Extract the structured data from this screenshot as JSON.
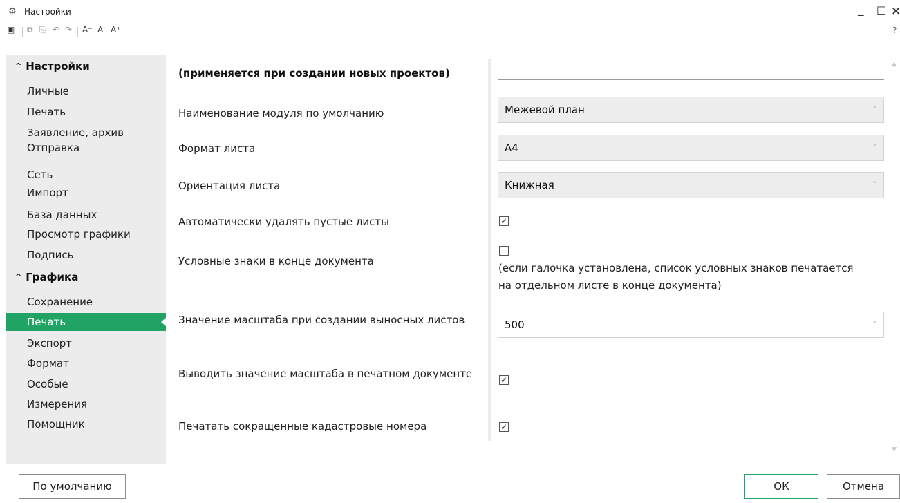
{
  "window": {
    "title": "Настройки",
    "help_label": "?"
  },
  "sidebar": {
    "groups": [
      {
        "label": "Настройки",
        "items": [
          "Личные",
          "Печать",
          "Заявление, архив",
          "Отправка",
          "Сеть",
          "Импорт",
          "База данных",
          "Просмотр графики",
          "Подпись"
        ]
      },
      {
        "label": "Графика",
        "items": [
          "Сохранение",
          "Печать",
          "Экспорт",
          "Формат",
          "Особые",
          "Измерения",
          "Помощник"
        ]
      }
    ],
    "active_item": "Графика / Печать",
    "accent_color": "#21a366"
  },
  "main": {
    "section_heading": "(применяется при создании новых проектов)",
    "fields": {
      "module_name": {
        "label": "Наименование модуля по умолчанию",
        "value": "Межевой план"
      },
      "sheet_format": {
        "label": "Формат листа",
        "value": "А4"
      },
      "orientation": {
        "label": "Ориентация листа",
        "value": "Книжная"
      },
      "auto_delete": {
        "label": "Автоматически удалять пустые листы",
        "checked": true
      },
      "symbols_end": {
        "label": "Условные знаки в конце документа",
        "checked": false,
        "note": "(если галочка установлена, список условных знаков печатается на отдельном листе в конце документа)"
      },
      "scale_value": {
        "label": "Значение масштаба при создании выносных листов",
        "value": "500"
      },
      "print_scale": {
        "label": "Выводить значение масштаба в печатном документе",
        "checked": true
      },
      "short_cadastral": {
        "label": "Печатать сокращенные кадастровые номера",
        "checked": true
      }
    }
  },
  "footer": {
    "default_button": "По умолчанию",
    "ok_button": "ОК",
    "cancel_button": "Отмена"
  }
}
